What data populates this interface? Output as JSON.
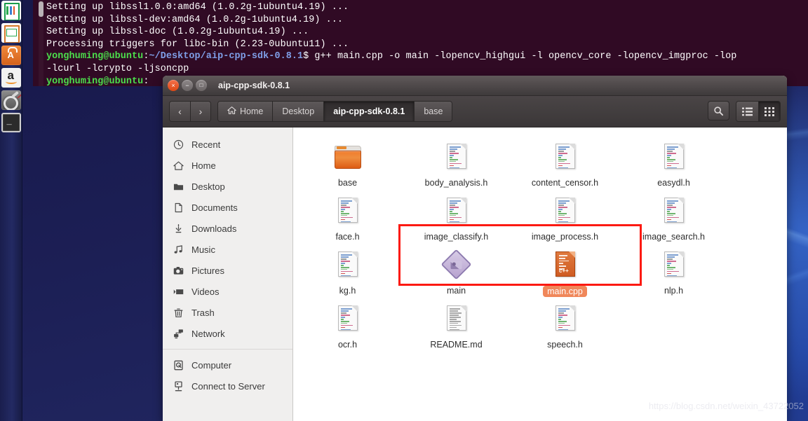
{
  "desktop": {
    "launcher": [
      {
        "name": "libreoffice-calc-icon",
        "label": "LibreOffice Calc"
      },
      {
        "name": "libreoffice-impress-icon",
        "label": "LibreOffice Impress"
      },
      {
        "name": "ubuntu-software-center-icon",
        "label": "Ubuntu Software Center"
      },
      {
        "name": "amazon-icon",
        "label": "Amazon"
      },
      {
        "name": "system-settings-icon",
        "label": "System Settings"
      },
      {
        "name": "terminal-icon",
        "label": "Terminal"
      }
    ]
  },
  "terminal": {
    "lines": [
      [
        {
          "t": "Setting up libssl1.0.0:amd64 (1.0.2g-1ubuntu4.19) ...",
          "c": "w"
        }
      ],
      [
        {
          "t": "Setting up libssl-dev:amd64 (1.0.2g-1ubuntu4.19) ...",
          "c": "w"
        }
      ],
      [
        {
          "t": "Setting up libssl-doc (1.0.2g-1ubuntu4.19) ...",
          "c": "w"
        }
      ],
      [
        {
          "t": "Processing triggers for libc-bin (2.23-0ubuntu11) ...",
          "c": "w"
        }
      ],
      [
        {
          "t": "yonghuming@ubuntu",
          "c": "u"
        },
        {
          "t": ":",
          "c": "w"
        },
        {
          "t": "~/Desktop/aip-cpp-sdk-0.8.1",
          "c": "p"
        },
        {
          "t": "$ g++ main.cpp -o main -lopencv_highgui -l opencv_core -lopencv_imgproc -lop",
          "c": "w"
        }
      ],
      [
        {
          "t": "-lcurl -lcrypto -ljsoncpp",
          "c": "w"
        }
      ],
      [
        {
          "t": "yonghuming@ubuntu",
          "c": "u"
        },
        {
          "t": ":",
          "c": "w"
        }
      ]
    ]
  },
  "window": {
    "title": "aip-cpp-sdk-0.8.1",
    "controls": {
      "close": "×",
      "minimize": "−",
      "maximize": "□"
    },
    "nav": {
      "back": "‹",
      "forward": "›"
    },
    "breadcrumbs": [
      {
        "label": "Home",
        "icon": "home-icon",
        "active": false
      },
      {
        "label": "Desktop",
        "icon": "",
        "active": false
      },
      {
        "label": "aip-cpp-sdk-0.8.1",
        "icon": "",
        "active": true
      },
      {
        "label": "base",
        "icon": "",
        "active": false
      }
    ],
    "toolbar_right": [
      {
        "name": "search-icon",
        "glyph": "⌕",
        "active": false
      },
      {
        "name": "list-view-icon",
        "glyph": "☰",
        "active": false
      },
      {
        "name": "grid-view-icon",
        "glyph": "⁙",
        "active": true
      }
    ]
  },
  "sidebar": {
    "groups": [
      {
        "items": [
          {
            "label": "Recent",
            "icon": "clock-icon"
          },
          {
            "label": "Home",
            "icon": "home-icon"
          },
          {
            "label": "Desktop",
            "icon": "folder-icon"
          },
          {
            "label": "Documents",
            "icon": "document-icon"
          },
          {
            "label": "Downloads",
            "icon": "download-icon"
          },
          {
            "label": "Music",
            "icon": "music-icon"
          },
          {
            "label": "Pictures",
            "icon": "camera-icon"
          },
          {
            "label": "Videos",
            "icon": "video-icon"
          },
          {
            "label": "Trash",
            "icon": "trash-icon"
          },
          {
            "label": "Network",
            "icon": "network-icon"
          }
        ]
      },
      {
        "items": [
          {
            "label": "Computer",
            "icon": "computer-icon"
          },
          {
            "label": "Connect to Server",
            "icon": "server-icon"
          }
        ]
      }
    ]
  },
  "files": {
    "rows": [
      [
        {
          "name": "base",
          "type": "folder",
          "selected": false
        },
        {
          "name": "body_analysis.h",
          "type": "source",
          "selected": false
        },
        {
          "name": "content_censor.h",
          "type": "source",
          "selected": false
        },
        {
          "name": "easydl.h",
          "type": "source",
          "selected": false
        }
      ],
      [
        {
          "name": "face.h",
          "type": "source",
          "selected": false
        },
        {
          "name": "image_classify.h",
          "type": "source",
          "selected": false
        },
        {
          "name": "image_process.h",
          "type": "source",
          "selected": false
        },
        {
          "name": "image_search.h",
          "type": "source",
          "selected": false
        }
      ],
      [
        {
          "name": "kg.h",
          "type": "source",
          "selected": false
        },
        {
          "name": "main",
          "type": "executable",
          "selected": false
        },
        {
          "name": "main.cpp",
          "type": "cpp",
          "selected": true
        },
        {
          "name": "nlp.h",
          "type": "source",
          "selected": false
        }
      ],
      [
        {
          "name": "ocr.h",
          "type": "source",
          "selected": false
        },
        {
          "name": "README.md",
          "type": "text",
          "selected": false
        },
        {
          "name": "speech.h",
          "type": "source",
          "selected": false
        }
      ]
    ],
    "cpp_tag": "c++"
  },
  "annotation": {
    "name": "red-highlight-rectangle",
    "color": "#fc1a12"
  },
  "watermark": "https://blog.csdn.net/weixin_43722052"
}
